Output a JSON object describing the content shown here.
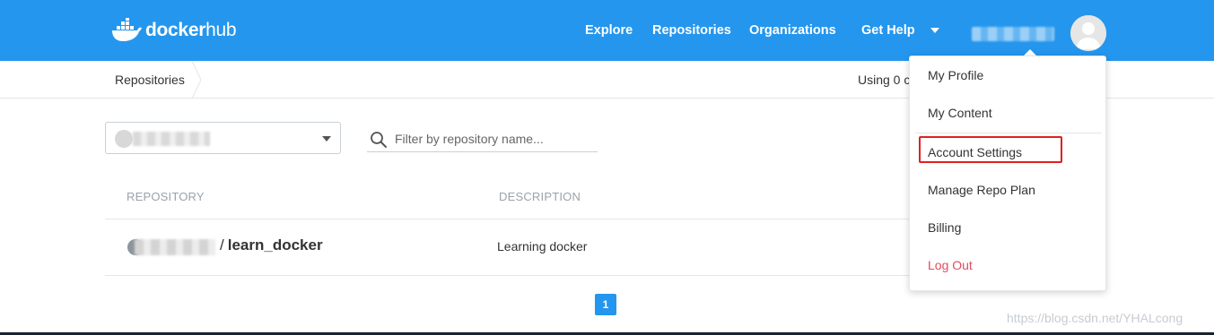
{
  "header": {
    "logo_text_bold": "docker",
    "logo_text_light": "hub",
    "nav": {
      "explore": "Explore",
      "repositories": "Repositories",
      "organizations": "Organizations",
      "get_help": "Get Help"
    },
    "brand_color": "#2496ed"
  },
  "breadcrumb": {
    "current": "Repositories",
    "usage_text": "Using 0 c"
  },
  "filters": {
    "search_placeholder": "Filter by repository name..."
  },
  "table": {
    "columns": [
      "REPOSITORY",
      "DESCRIPTION"
    ],
    "rows": [
      {
        "name": "learn_docker",
        "description": "Learning docker"
      }
    ]
  },
  "pagination": {
    "current_page": "1"
  },
  "user_menu": {
    "items": [
      "My Profile",
      "My Content",
      "Account Settings",
      "Manage Repo Plan",
      "Billing",
      "Log Out"
    ],
    "highlighted": "Account Settings",
    "logout_color": "#e04a5f"
  },
  "watermark": "https://blog.csdn.net/YHALcong"
}
